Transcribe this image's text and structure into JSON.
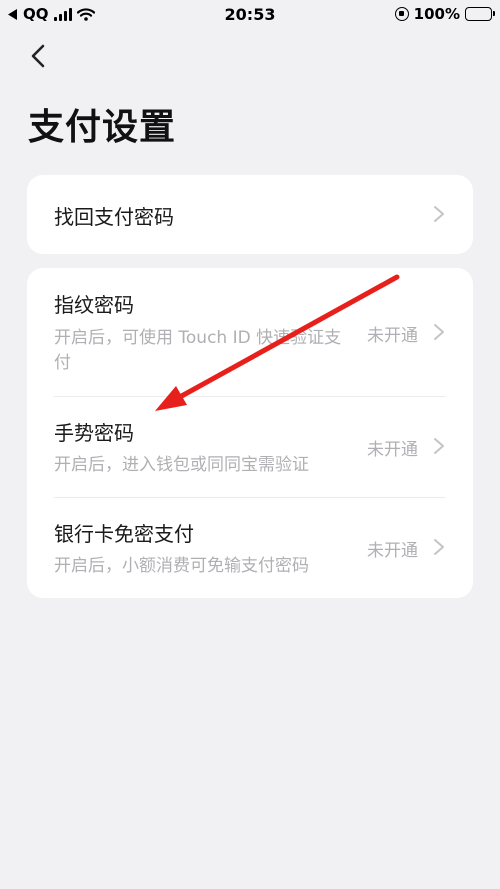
{
  "status_bar": {
    "carrier": "QQ",
    "time": "20:53",
    "battery": "100%",
    "battery_level": 1.0
  },
  "header": {
    "title": "支付设置"
  },
  "retrieve": {
    "label": "找回支付密码"
  },
  "settings": [
    {
      "title": "指纹密码",
      "description": "开启后，可使用 Touch ID 快速验证支付",
      "status": "未开通"
    },
    {
      "title": "手势密码",
      "description": "开启后，进入钱包或同同宝需验证",
      "status": "未开通"
    },
    {
      "title": "银行卡免密支付",
      "description": "开启后，小额消费可免输支付密码",
      "status": "未开通"
    }
  ],
  "annotation": {
    "color": "#e8201c"
  }
}
